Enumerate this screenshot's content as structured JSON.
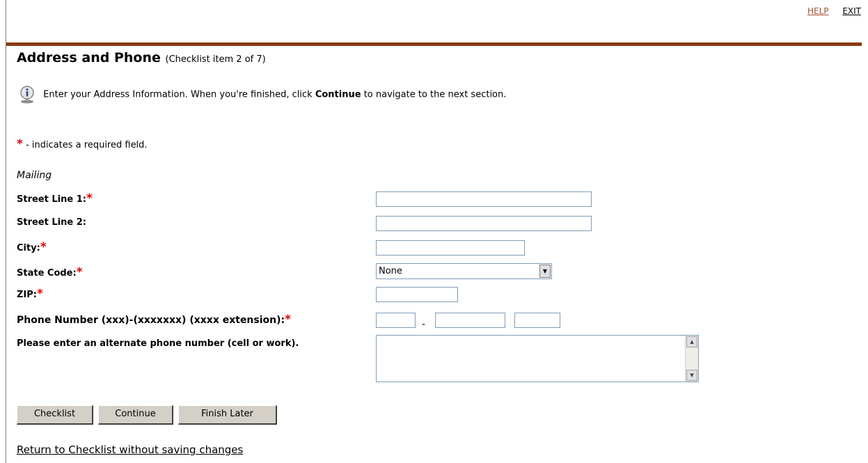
{
  "top_links": {
    "help": "HELP",
    "exit": "EXIT"
  },
  "colors": {
    "brand_bar": "#8b3a0f",
    "help_link": "#a0522d",
    "required_star": "#e00000"
  },
  "page": {
    "title": "Address and Phone",
    "subtitle": "(Checklist item 2 of 7)",
    "info_prefix": "Enter your Address Information. When you're finished, click",
    "info_bold": "Continue",
    "info_suffix": "to navigate to the next section.",
    "info_icon": "info-icon",
    "required_star": "*",
    "required_note": " - indicates a required field."
  },
  "form": {
    "section": "Mailing",
    "street1_label": "Street Line 1:",
    "street1_value": "",
    "street2_label": "Street Line 2:",
    "street2_value": "",
    "city_label": "City:",
    "city_value": "",
    "state_label": "State Code:",
    "state_selected": "None",
    "zip_label": "ZIP:",
    "zip_value": "",
    "phone_label": "Phone Number (xxx)-(xxxxxxx) (xxxx extension):",
    "phone_area": "",
    "phone_separator": "-",
    "phone_number": "",
    "phone_ext": "",
    "alt_phone_label": "Please enter an alternate phone number (cell or work).",
    "alt_phone_value": ""
  },
  "buttons": {
    "checklist": "Checklist",
    "continue": "Continue",
    "finish_later": "Finish Later"
  },
  "return_link": "Return to Checklist without saving changes"
}
